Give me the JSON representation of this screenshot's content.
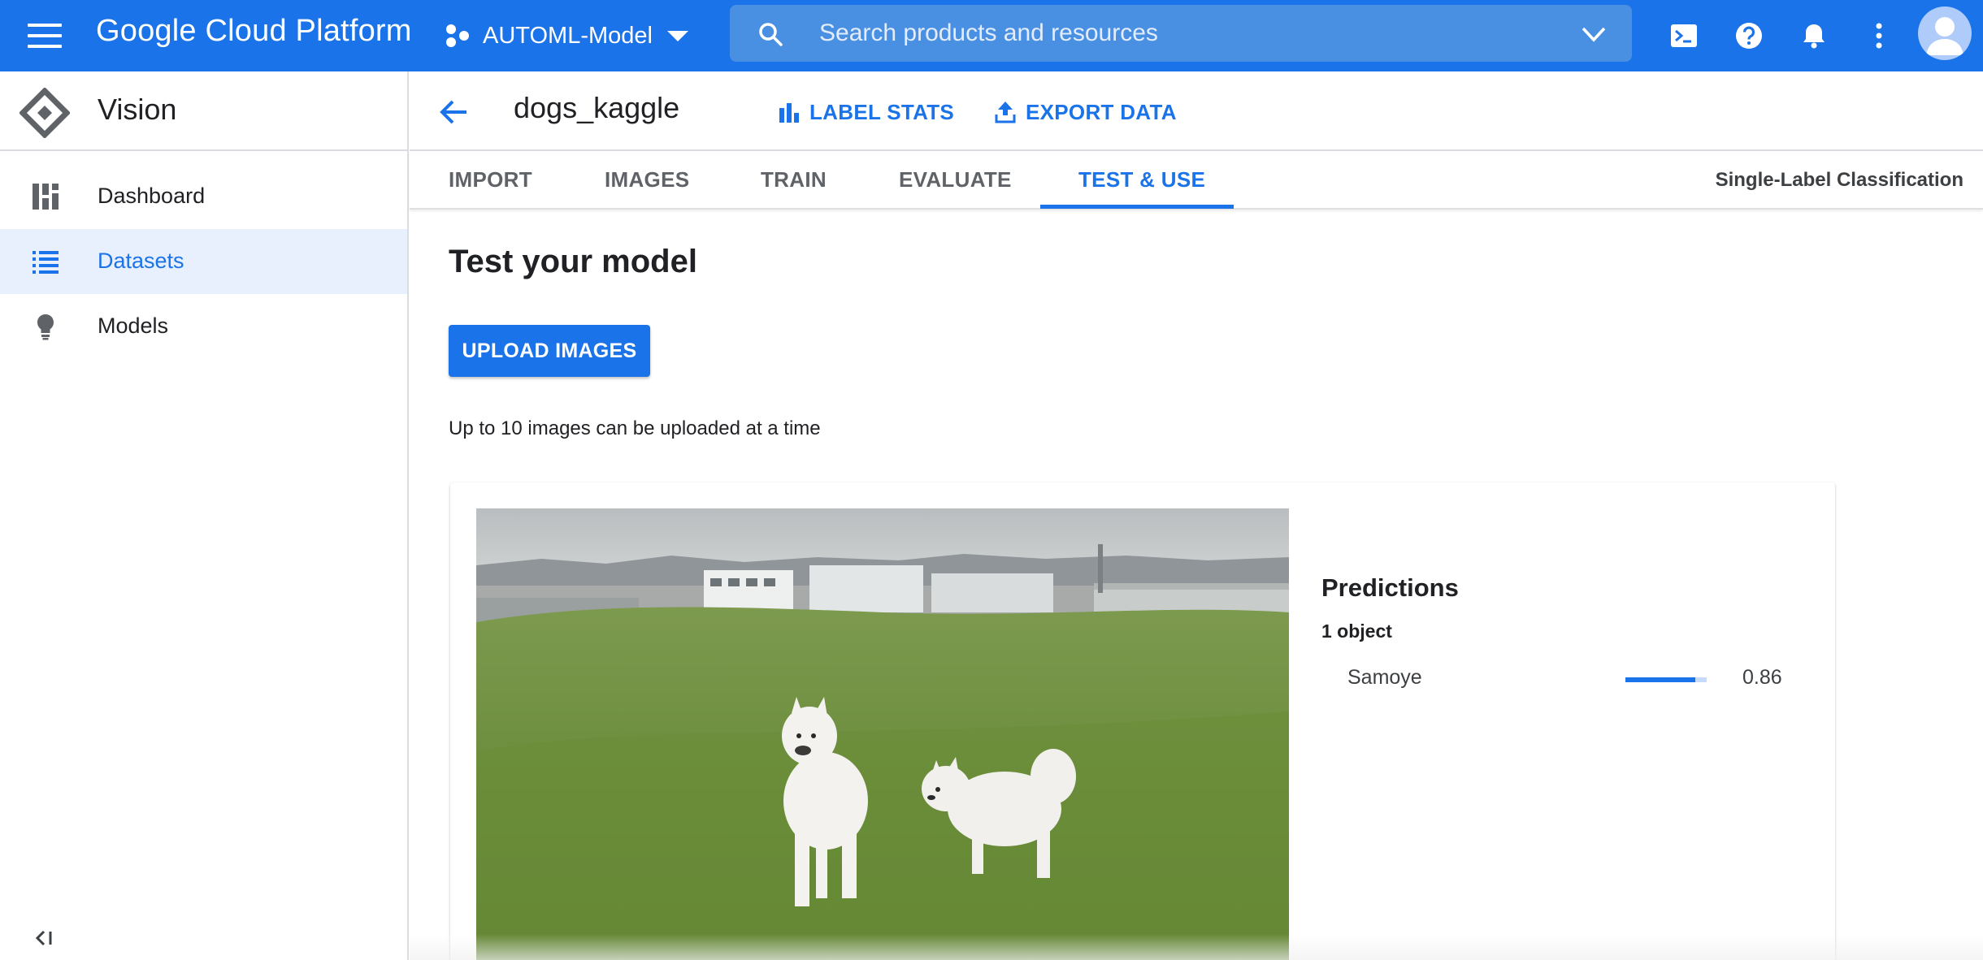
{
  "topbar": {
    "app_title": "Google Cloud Platform",
    "project_name": "AUTOML-Model",
    "search_placeholder": "Search products and resources",
    "brand_color": "#1a73e8",
    "icons": [
      "menu-icon",
      "cloud-shell-icon",
      "help-icon",
      "notifications-icon",
      "more-vert-icon",
      "account-avatar"
    ]
  },
  "sidebar": {
    "product_name": "Vision",
    "items": [
      {
        "label": "Dashboard",
        "icon": "dashboard-icon",
        "active": false
      },
      {
        "label": "Datasets",
        "icon": "list-icon",
        "active": true
      },
      {
        "label": "Models",
        "icon": "lightbulb-icon",
        "active": false
      }
    ],
    "collapse_label": "<I"
  },
  "header": {
    "dataset_name": "dogs_kaggle",
    "label_stats": "LABEL STATS",
    "export_data": "EXPORT DATA"
  },
  "tabs": {
    "items": [
      "IMPORT",
      "IMAGES",
      "TRAIN",
      "EVALUATE",
      "TEST & USE"
    ],
    "active": "TEST & USE",
    "classification": "Single-Label Classification"
  },
  "main": {
    "title": "Test your model",
    "upload_button": "UPLOAD IMAGES",
    "upload_hint": "Up to 10 images can be uploaded at a time"
  },
  "predictions": {
    "title": "Predictions",
    "count": "1 object",
    "results": [
      {
        "label": "Samoye",
        "score": "0.86",
        "bar_fraction": 0.86
      }
    ]
  }
}
